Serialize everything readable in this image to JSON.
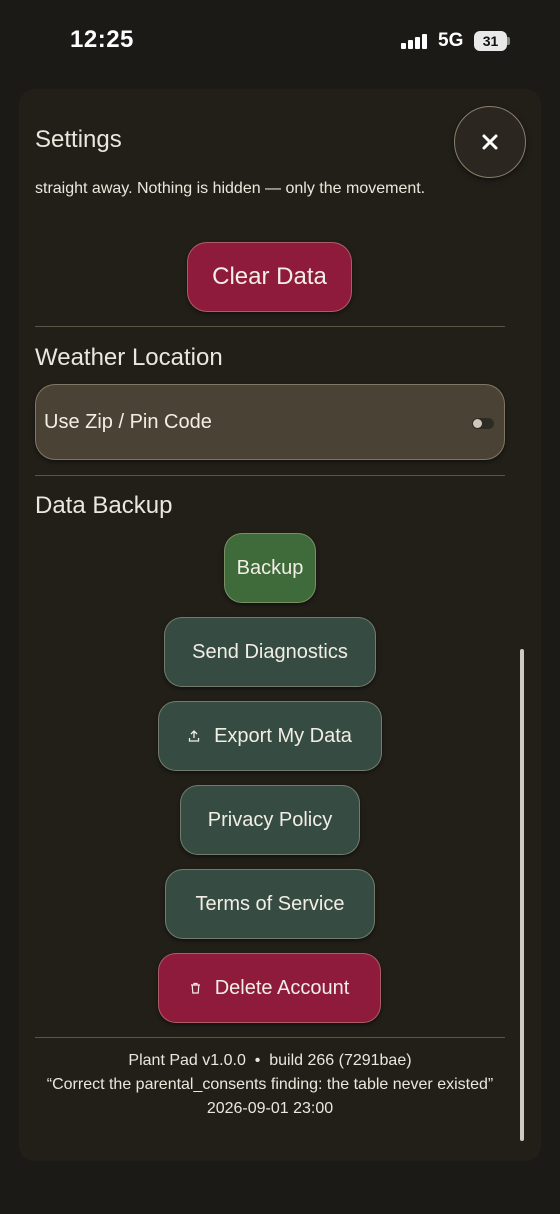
{
  "status_bar": {
    "time": "12:25",
    "network": "5G",
    "battery": "31"
  },
  "sheet": {
    "title": "Settings",
    "description": "straight away. Nothing is hidden — only the movement.",
    "clear_data_label": "Clear Data",
    "weather": {
      "title": "Weather Location",
      "zip_label": "Use Zip / Pin Code",
      "zip_enabled": false
    },
    "backup": {
      "title": "Data Backup",
      "buttons": {
        "backup": "Backup",
        "send_diagnostics": "Send Diagnostics",
        "export": "Export My Data",
        "privacy": "Privacy Policy",
        "terms": "Terms of Service",
        "delete": "Delete Account"
      }
    },
    "footer": {
      "version_line": "Plant Pad v1.0.0  •  build 266 (7291bae)",
      "commit_message": "“Correct the parental_consents finding: the table never existed”",
      "timestamp": "2026-09-01 23:00"
    }
  },
  "colors": {
    "danger": "#8e1b3c",
    "green": "#3f6a3a",
    "teal": "#364c42",
    "sheet_bg": "#221f19"
  },
  "icons": [
    "close-icon",
    "upload-icon",
    "trash-icon",
    "cellular-signal-icon",
    "battery-icon"
  ]
}
